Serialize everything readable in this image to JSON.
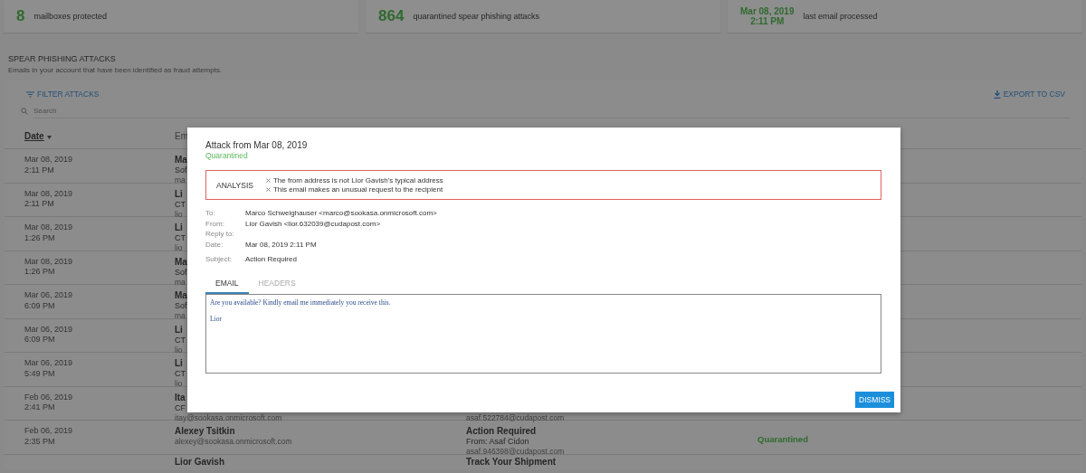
{
  "stats": [
    {
      "value_lines": [
        "8"
      ],
      "label": "mailboxes protected"
    },
    {
      "value_lines": [
        "864"
      ],
      "label": "quarantined spear phishing attacks"
    },
    {
      "value_lines": [
        "Mar 08, 2019",
        "2:11 PM"
      ],
      "label": "last email processed"
    }
  ],
  "section": {
    "title": "SPEAR PHISHING ATTACKS",
    "subtitle": "Emails in your account that have been identified as fraud attempts."
  },
  "toolbar": {
    "filter": "FILTER ATTACKS",
    "export": "EXPORT TO CSV",
    "search": {
      "placeholder": "Search"
    }
  },
  "table": {
    "columns": [
      {
        "label": "Date",
        "sorted": true
      },
      {
        "label": "Em",
        "sorted": false
      }
    ],
    "rows": [
      {
        "date": "Mar 08, 2019",
        "time": "2:11 PM",
        "email": {
          "name": "Ma",
          "title": "Sof",
          "address": "ma"
        }
      },
      {
        "date": "Mar 08, 2019",
        "time": "2:11 PM",
        "email": {
          "name": "Li",
          "title": "CT",
          "address": "lio"
        }
      },
      {
        "date": "Mar 08, 2019",
        "time": "1:26 PM",
        "email": {
          "name": "Li",
          "title": "CT",
          "address": "lio"
        }
      },
      {
        "date": "Mar 08, 2019",
        "time": "1:26 PM",
        "email": {
          "name": "Ma",
          "title": "Sof",
          "address": "ma"
        }
      },
      {
        "date": "Mar 06, 2019",
        "time": "6:09 PM",
        "email": {
          "name": "Ma",
          "title": "Sof",
          "address": "ma"
        }
      },
      {
        "date": "Mar 06, 2019",
        "time": "6:09 PM",
        "email": {
          "name": "Li",
          "title": "CT",
          "address": "lio"
        }
      },
      {
        "date": "Mar 06, 2019",
        "time": "5:49 PM",
        "email": {
          "name": "Li",
          "title": "CT",
          "address": "lio"
        }
      },
      {
        "date": "Feb 06, 2019",
        "time": "2:41 PM",
        "email": {
          "name": "Ita",
          "title": "CF",
          "address": "itay@sookasa.onmicrosoft.com"
        },
        "subject": {
          "address": "asaf.522784@cudapost.com"
        }
      },
      {
        "date": "Feb 06, 2019",
        "time": "2:35 PM",
        "email": {
          "name": "Alexey Tsitkin",
          "address": "alexey@sookasa.onmicrosoft.com"
        },
        "subject": {
          "title": "Action Required",
          "from": "From: Asaf Cidon",
          "address": "asaf.946398@cudapost.com"
        },
        "status": "Quarantined"
      },
      {
        "email": {
          "name": "Lior Gavish"
        },
        "subject": {
          "title": "Track Your Shipment"
        }
      }
    ]
  },
  "modal": {
    "title": "Attack from Mar 08, 2019",
    "status": "Quarantined",
    "analysis": {
      "label": "ANALYSIS",
      "items": [
        "The from address is not Lior Gavish's typical address",
        "This email makes an unusual request to the recipient"
      ]
    },
    "fields": [
      {
        "label": "To:",
        "value": "Marco Schweighauser <marco@sookasa.onmicrosoft.com>"
      },
      {
        "label": "From:",
        "value": "Lior Gavish <lior.632039@cudapost.com>"
      },
      {
        "label": "Reply to:"
      },
      {
        "label": "Date:",
        "value": "Mar 08, 2019 2:11 PM"
      },
      {
        "label": "Subject:",
        "value": "Action Required"
      }
    ],
    "tabs": [
      {
        "label": "EMAIL",
        "selected": true
      },
      {
        "label": "HEADERS",
        "selected": false
      }
    ],
    "body": [
      "Are you available? Kindly email me immediately you receive this.",
      "Lior"
    ],
    "button": "DISMISS"
  }
}
